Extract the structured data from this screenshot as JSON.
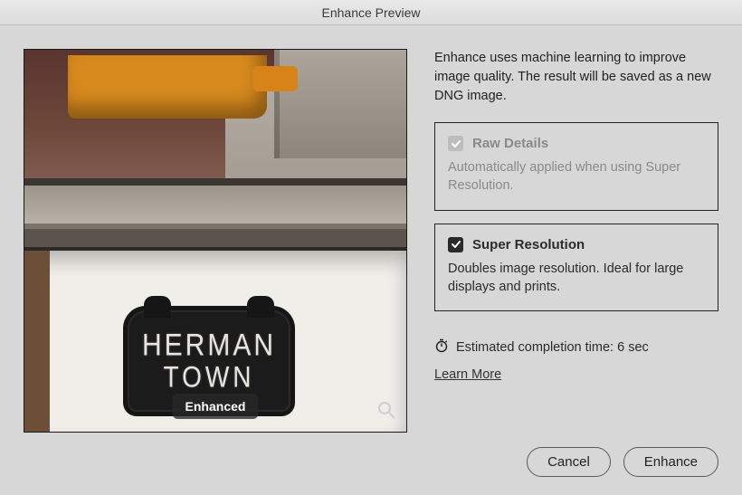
{
  "window_title": "Enhance Preview",
  "intro_text": "Enhance uses machine learning to improve image quality. The result will be saved as a new DNG image.",
  "preview": {
    "badge_label": "Enhanced",
    "sign_line1": "HERMAN",
    "sign_line2": "TOWN"
  },
  "options": {
    "raw_details": {
      "title": "Raw Details",
      "description": "Automatically applied when using Super Resolution.",
      "checked": true,
      "disabled": true
    },
    "super_resolution": {
      "title": "Super Resolution",
      "description": "Doubles image resolution. Ideal for large displays and prints.",
      "checked": true,
      "disabled": false
    }
  },
  "estimate_text": "Estimated completion time: 6 sec",
  "learn_more_label": "Learn More",
  "buttons": {
    "cancel": "Cancel",
    "confirm": "Enhance"
  }
}
